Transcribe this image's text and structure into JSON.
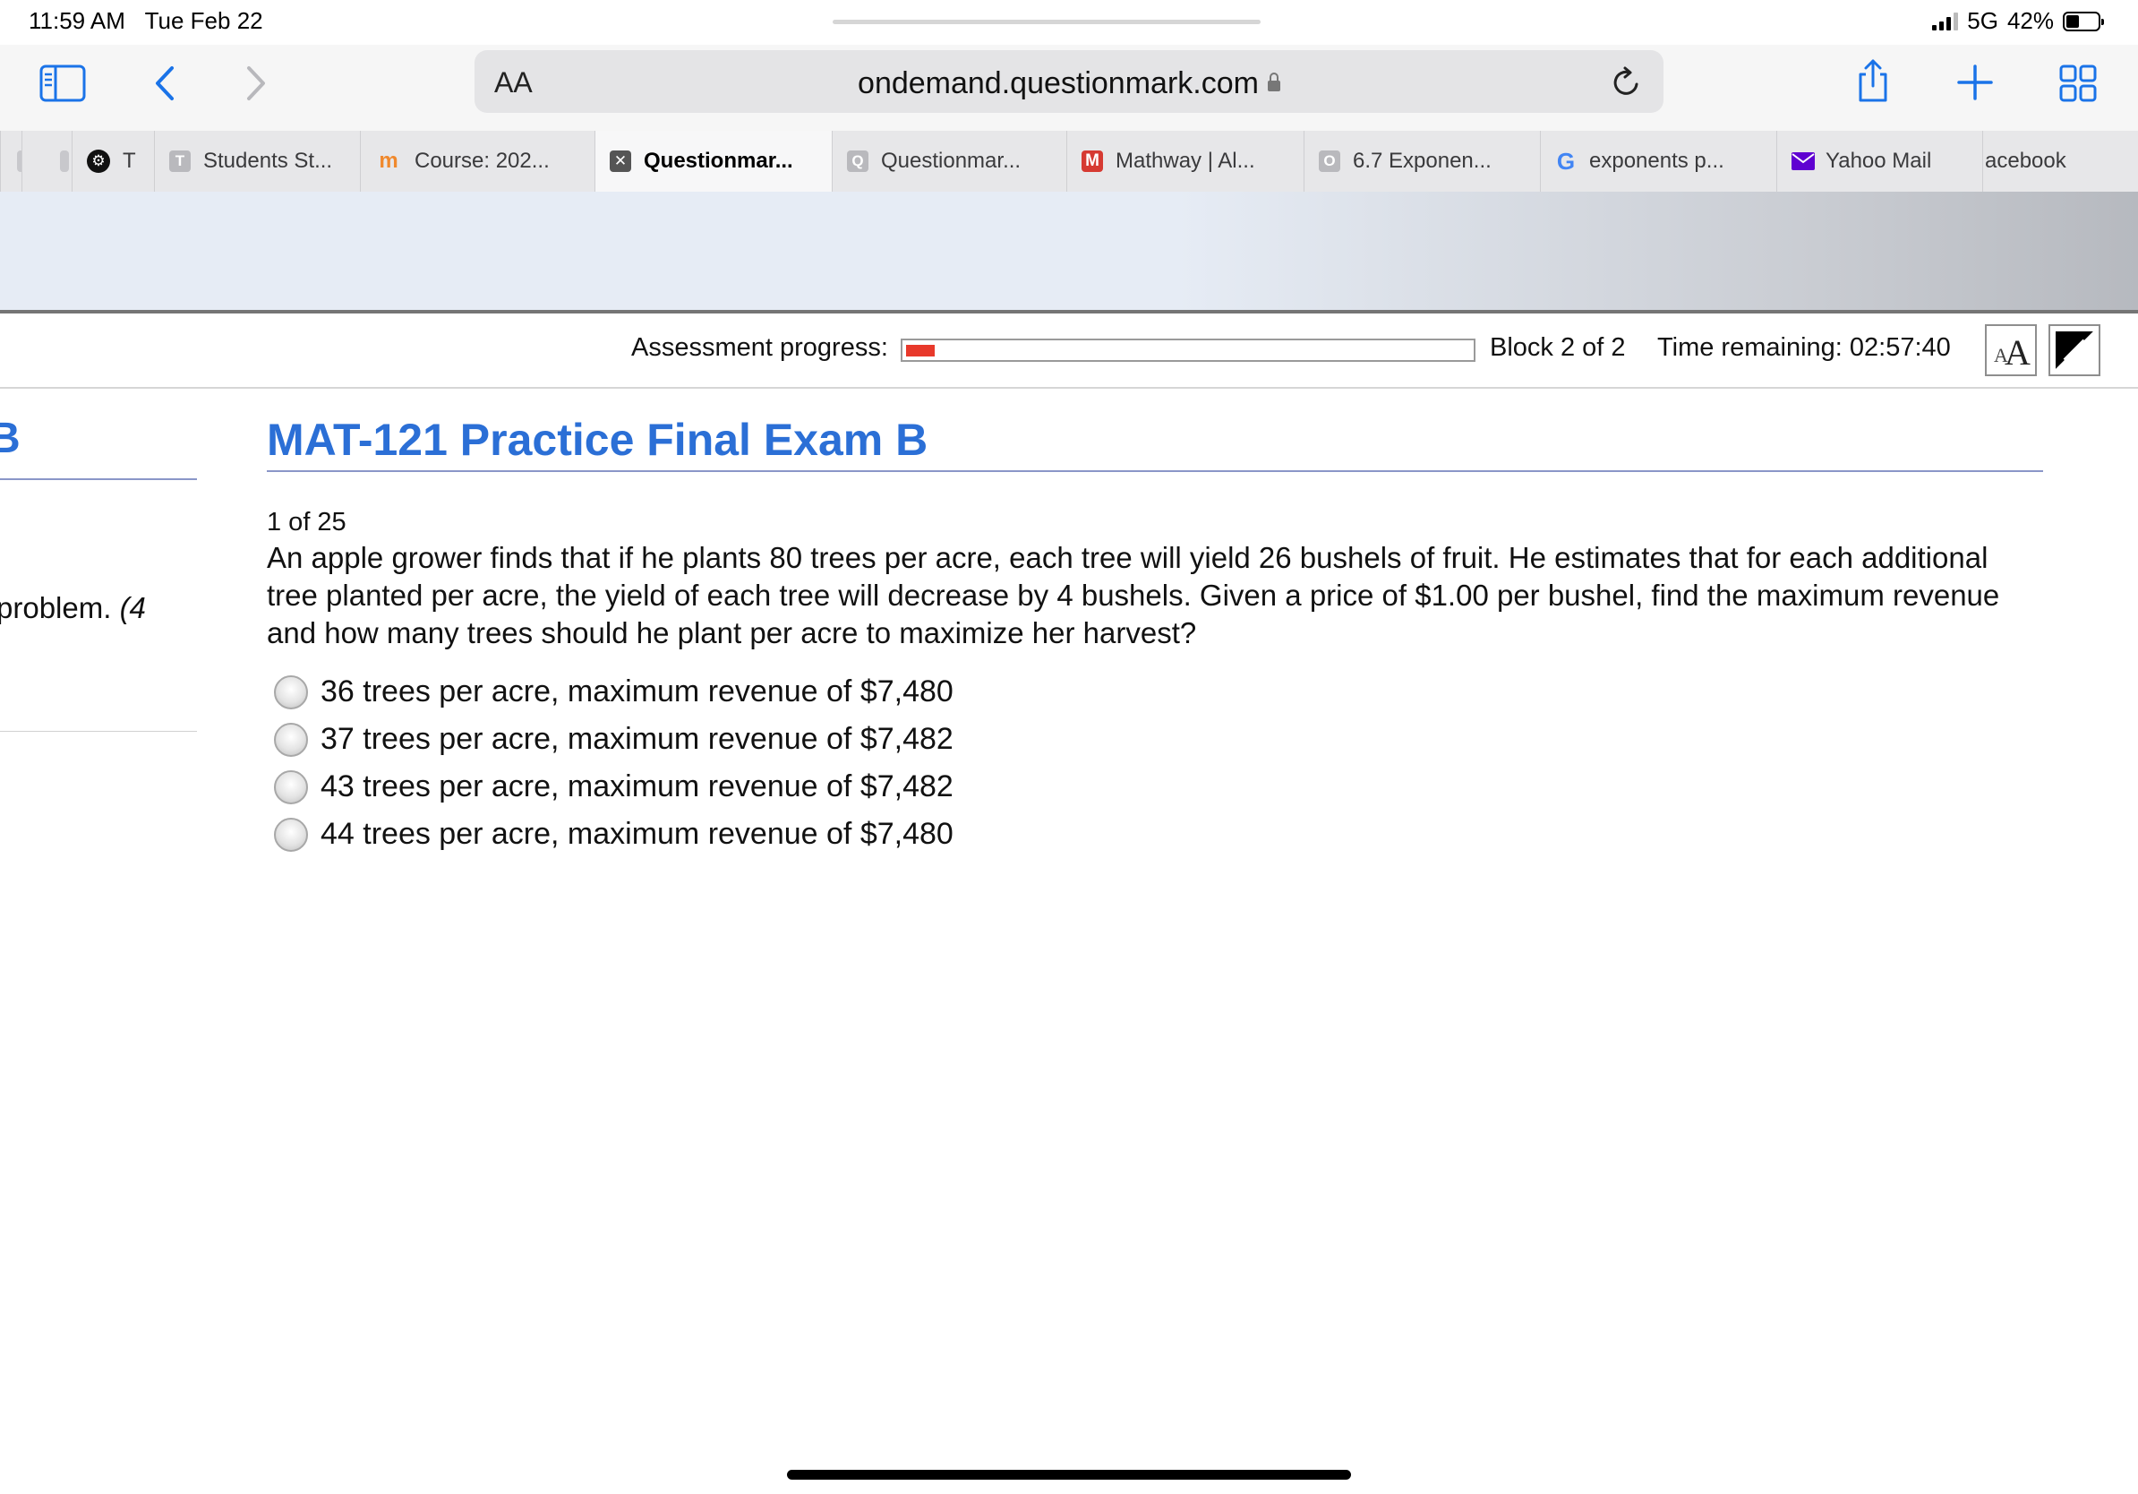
{
  "status_bar": {
    "time": "11:59 AM",
    "date": "Tue Feb 22",
    "network": "5G",
    "battery": "42%",
    "battery_level": 0.42
  },
  "browser": {
    "text_size_label": "AA",
    "url": "ondemand.questionmark.com",
    "tabs": [
      {
        "label": "T",
        "icon": "tab-favicon"
      },
      {
        "label": "Students St...",
        "icon": "t-favicon"
      },
      {
        "label": "Course: 202...",
        "icon": "moodle-favicon"
      },
      {
        "label": "Questionmar...",
        "icon": "close-icon",
        "active": true
      },
      {
        "label": "Questionmar...",
        "icon": "q-favicon"
      },
      {
        "label": "Mathway | Al...",
        "icon": "mathway-favicon"
      },
      {
        "label": "6.7 Exponen...",
        "icon": "o-favicon"
      },
      {
        "label": "exponents p...",
        "icon": "google-favicon"
      },
      {
        "label": "Yahoo Mail",
        "icon": "mail-favicon"
      },
      {
        "label": "acebook",
        "icon": ""
      }
    ]
  },
  "assessment": {
    "progress_label": "Assessment progress:",
    "progress_fraction": 0.05,
    "block_text": "Block 2 of 2",
    "time_remaining": "Time remaining: 02:57:40",
    "text_size_button": "AA",
    "contrast_button": "contrast-icon"
  },
  "sidebar": {
    "heading_fragment": "B",
    "text_fragment": "problem.",
    "text_fragment_italic": "(4"
  },
  "exam": {
    "title": "MAT-121 Practice Final Exam B",
    "question_number": "1  of 25",
    "question_text": "An apple grower finds that if he plants 80 trees per acre, each tree will yield 26 bushels of fruit. He estimates that for each additional tree planted per acre, the yield of each tree will decrease by 4 bushels. Given a price of $1.00 per bushel, find the maximum revenue and how many trees should he plant per acre to maximize her harvest?",
    "options": [
      "36 trees per acre, maximum revenue of $7,480",
      "37 trees per acre, maximum revenue of $7,482",
      "43 trees per acre, maximum revenue of $7,482",
      "44 trees per acre, maximum revenue of $7,480"
    ]
  },
  "colors": {
    "accent": "#2b6fd6",
    "progress": "#e8392b",
    "safari_blue": "#1a73e8"
  }
}
